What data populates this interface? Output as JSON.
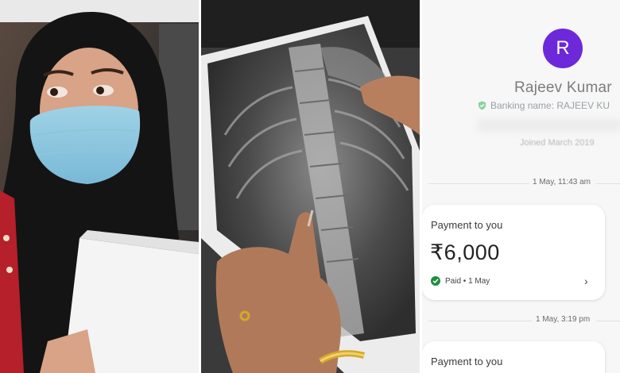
{
  "profile": {
    "initial": "R",
    "name": "Rajeev Kumar",
    "banking_name": "Banking name: RAJEEV KU",
    "joined": "Joined March 2019"
  },
  "transactions": [
    {
      "date": "1 May, 11:43 am",
      "title": "Payment to you",
      "amount": "₹6,000",
      "status": "Paid • 1 May"
    },
    {
      "date": "1 May, 3:19 pm",
      "title": "Payment to you"
    }
  ],
  "icons": {
    "check": "check-circle-icon",
    "shield": "verified-shield-icon",
    "chevron": "chevron-right-icon"
  },
  "colors": {
    "avatar_bg": "#6d28d9",
    "paid_green": "#1e8e3e"
  }
}
